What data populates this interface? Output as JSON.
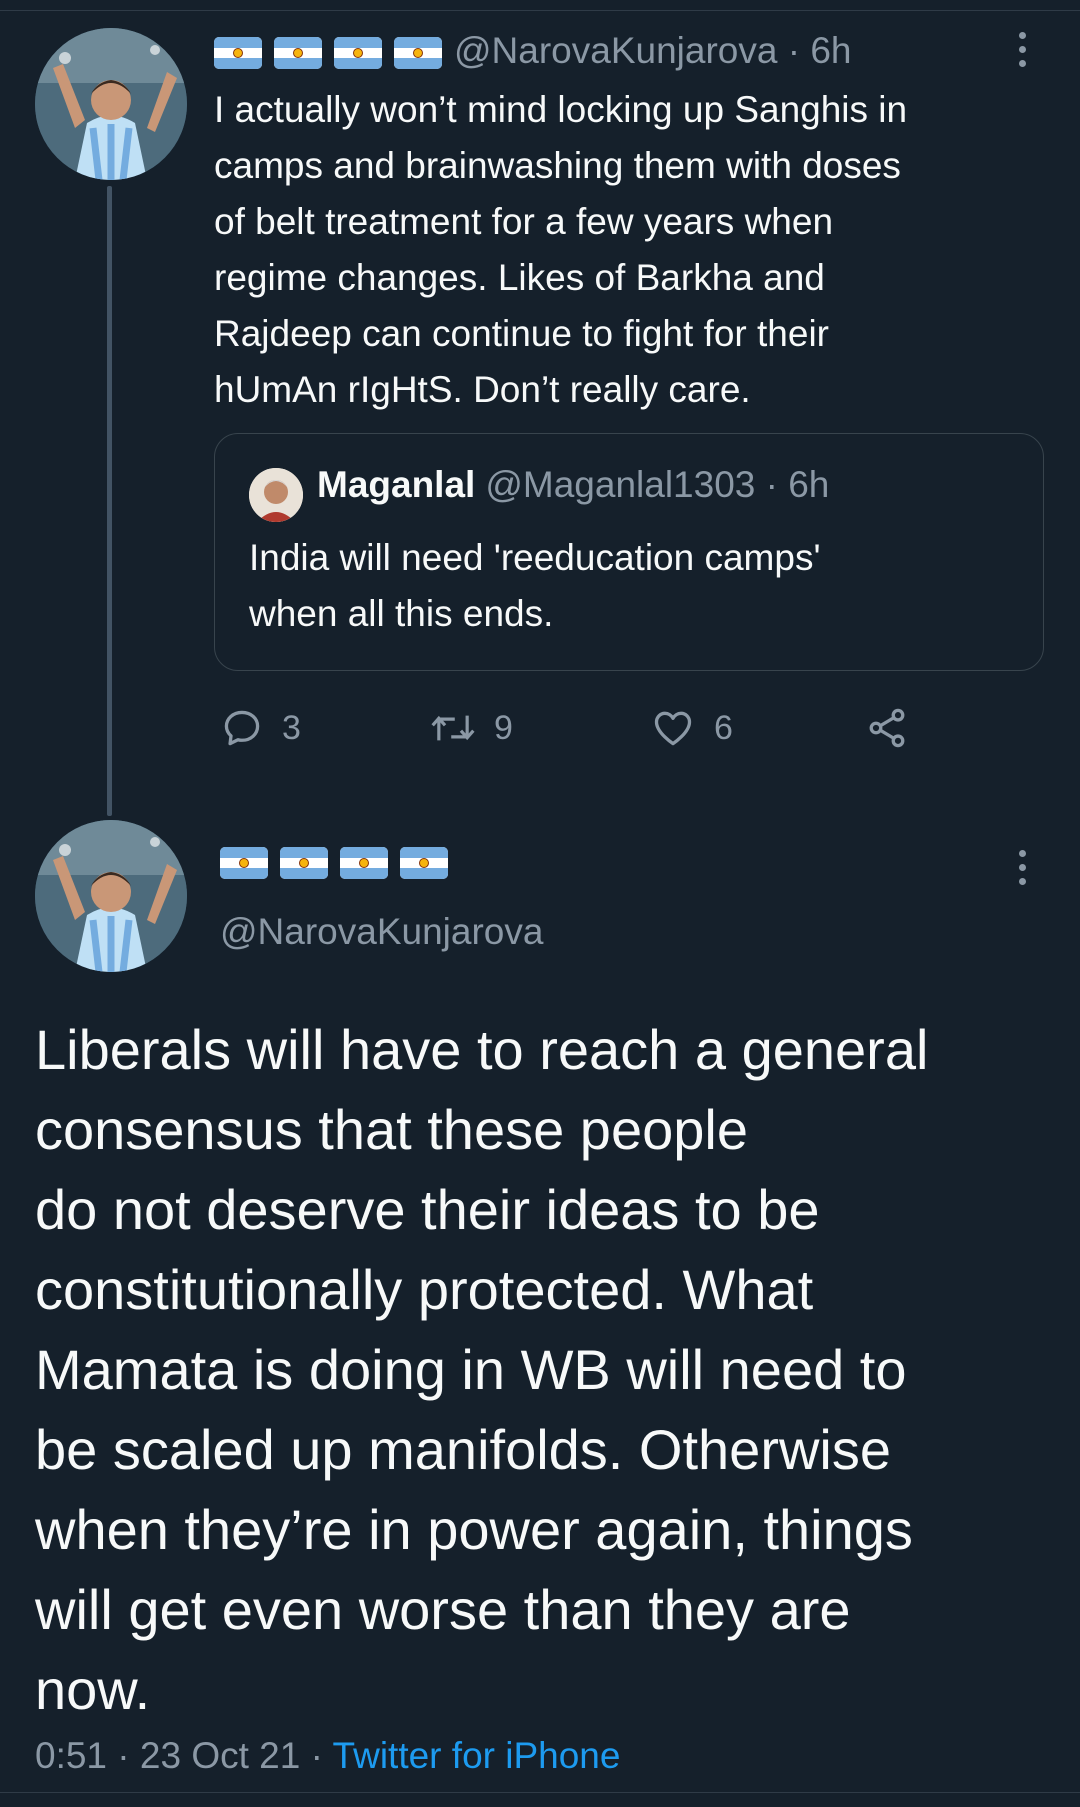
{
  "colors": {
    "background": "#15202b",
    "text": "#f7f9f9",
    "secondary_text": "#8b98a5",
    "link": "#1d9bf0",
    "border": "#38444d"
  },
  "tweet1": {
    "name_icons": [
      "argentina-flag-icon",
      "argentina-flag-icon",
      "argentina-flag-icon",
      "argentina-flag-icon"
    ],
    "handle_time": "@NarovaKunjarova · 6h",
    "text": "I actually won’t mind locking up Sanghis in\ncamps and brainwashing them with doses\nof belt treatment for a few years when\nregime changes. Likes of Barkha and\nRajdeep can continue to fight for their\nhUmAn rIgHtS. Don’t really care.",
    "quote": {
      "name": "Maganlal",
      "handle_time": "@Maganlal1303 · 6h",
      "text": "India will need 'reeducation camps'\nwhen all this ends."
    },
    "actions": {
      "replies": "3",
      "retweets": "9",
      "likes": "6"
    }
  },
  "tweet2": {
    "name_icons": [
      "argentina-flag-icon",
      "argentina-flag-icon",
      "argentina-flag-icon",
      "argentina-flag-icon"
    ],
    "handle": "@NarovaKunjarova",
    "text": "Liberals will have to reach a general\nconsensus that these people\ndo not deserve their ideas to be\nconstitutionally protected. What\nMamata is doing in WB will need to\nbe scaled up manifolds. Otherwise\nwhen they’re in power again, things\nwill get even worse than they are\nnow.",
    "time": "0:51 · 23 Oct 21 · ",
    "source": "Twitter for iPhone"
  }
}
